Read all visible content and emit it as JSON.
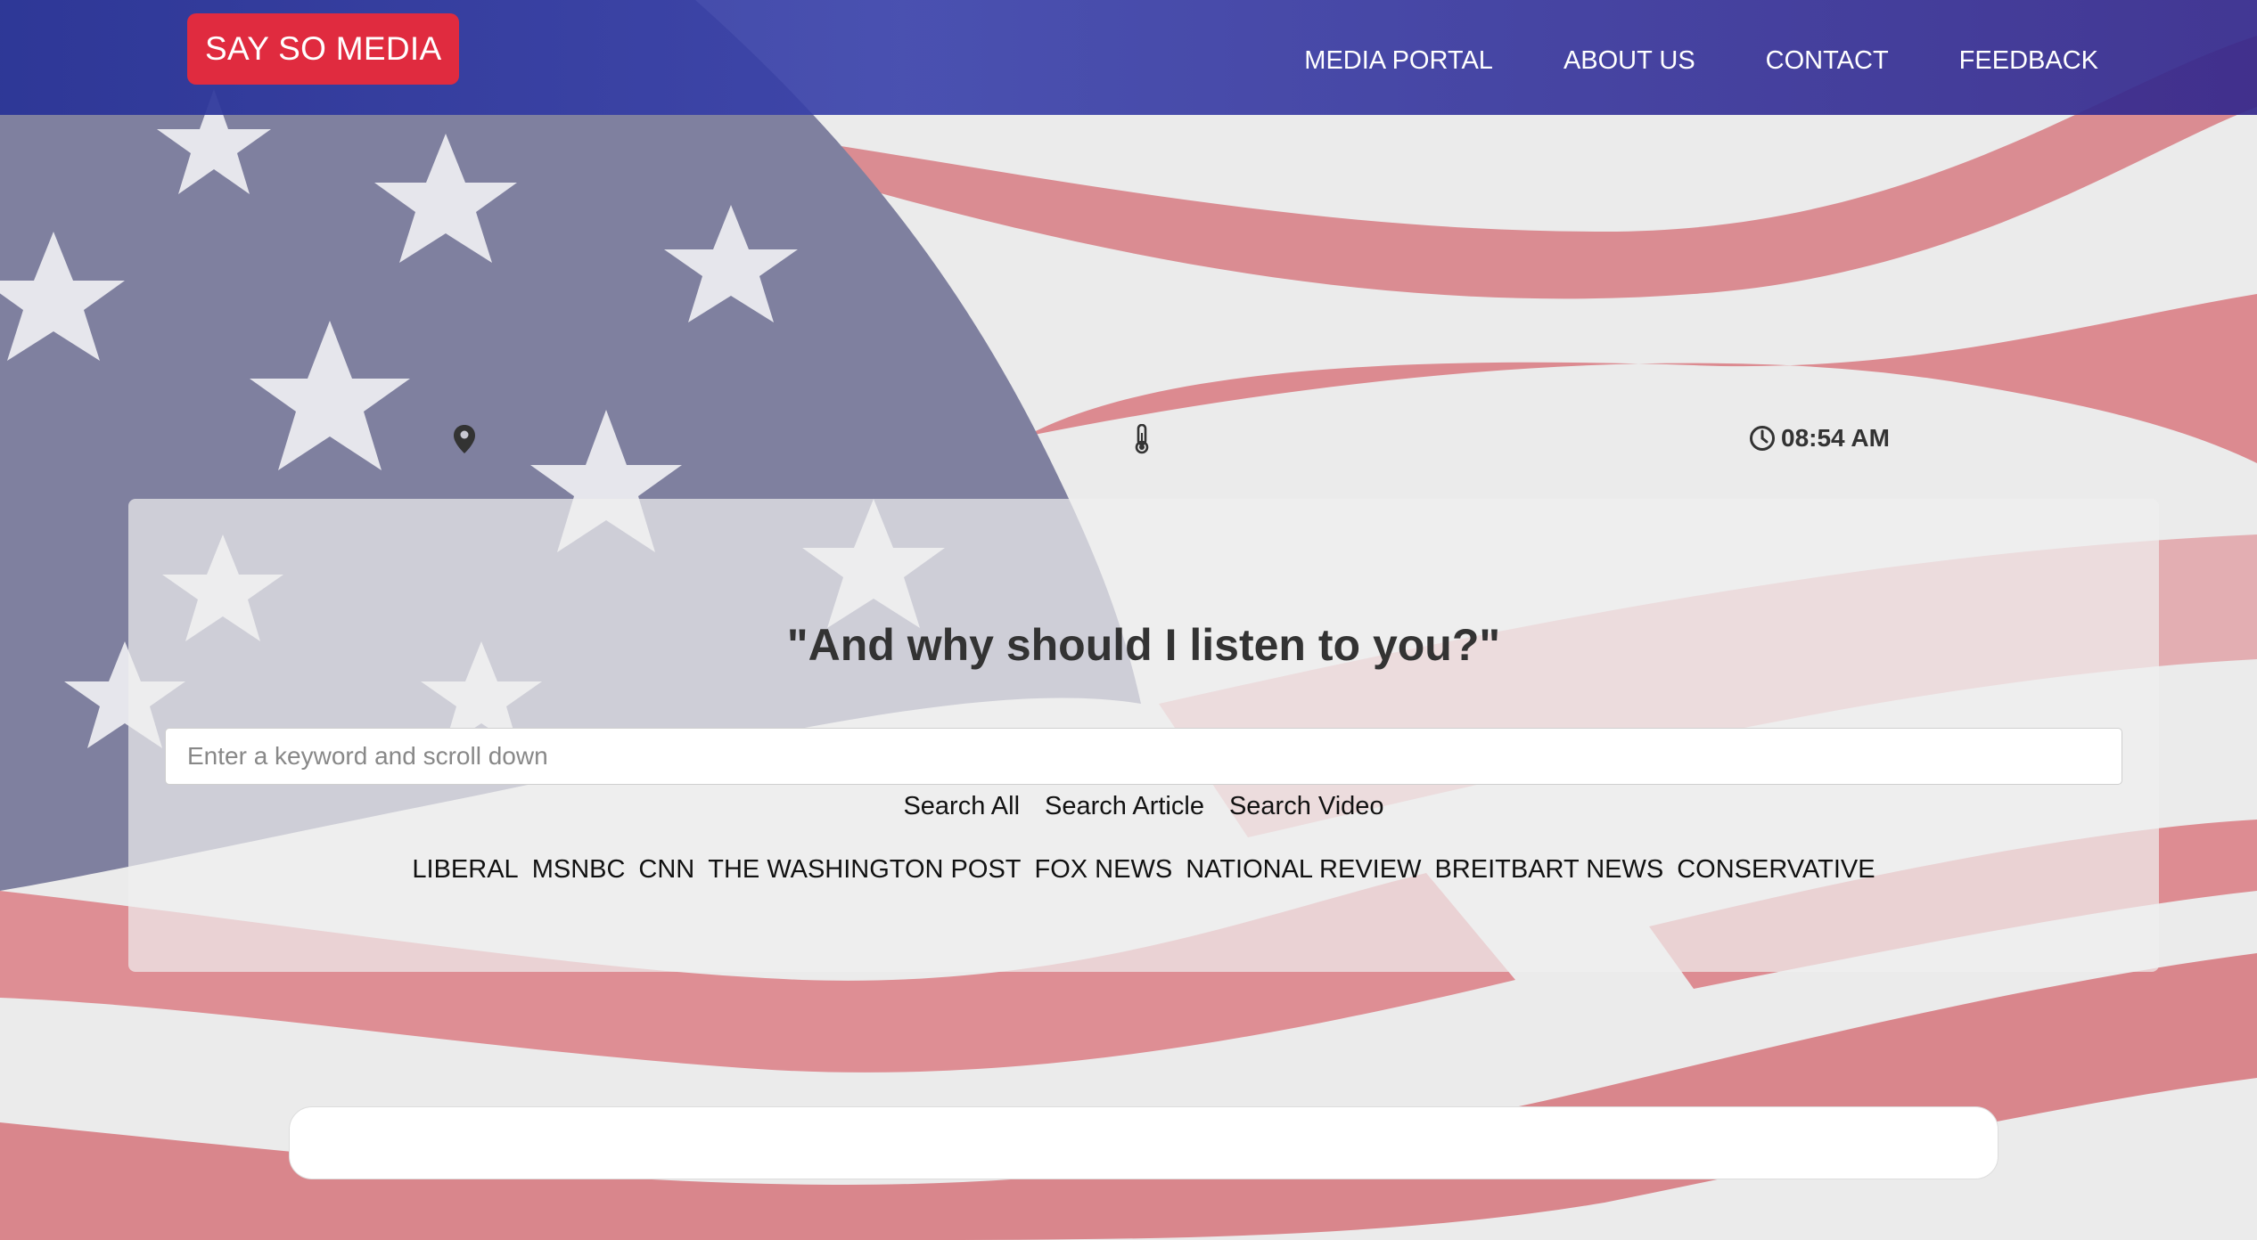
{
  "header": {
    "logo_text": "SAY SO MEDIA",
    "nav": [
      "MEDIA PORTAL",
      "ABOUT US",
      "CONTACT",
      "FEEDBACK"
    ]
  },
  "info": {
    "location_icon": "map-pin-icon",
    "temperature_icon": "thermometer-icon",
    "clock_icon": "clock-icon",
    "time": "08:54 AM"
  },
  "main": {
    "headline": "\"And why should I listen to you?\"",
    "search": {
      "placeholder": "Enter a keyword and scroll down",
      "value": ""
    },
    "search_buttons": [
      "Search All",
      "Search Article",
      "Search Video"
    ],
    "sources": [
      "LIBERAL",
      "MSNBC",
      "CNN",
      "THE WASHINGTON POST",
      "FOX NEWS",
      "NATIONAL REVIEW",
      "BREITBART NEWS",
      "CONSERVATIVE"
    ]
  },
  "colors": {
    "nav_background": "#2d34a0",
    "logo_background": "#e02b3f",
    "flag_blue": "#7e80a3",
    "flag_red": "#d9858b",
    "flag_white": "#ececec"
  }
}
